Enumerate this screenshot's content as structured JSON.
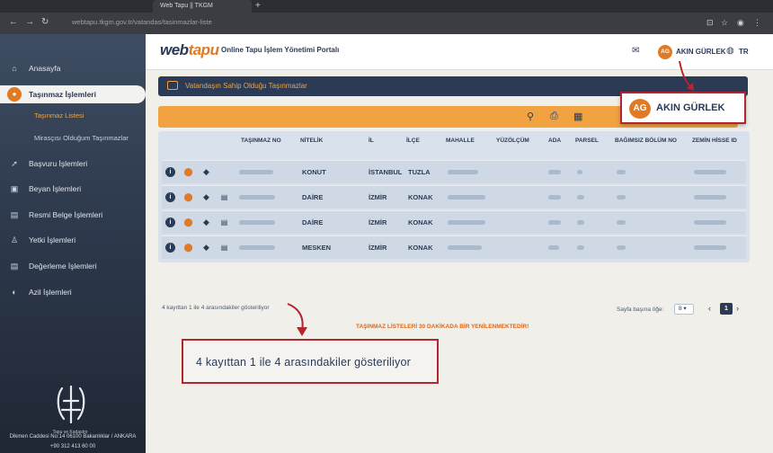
{
  "browser": {
    "tab1_title": "Web Tapu || TKGM",
    "url": "webtapu.tkgm.gov.tr/vatandas/tasinmazlar-liste"
  },
  "header": {
    "logo_main": "web",
    "logo_accent": "tapu",
    "portal_title": "Online Tapu İşlem Yönetimi Portalı",
    "avatar_initials": "AG",
    "user_name": "AKIN GÜRLEK",
    "language": "TR"
  },
  "sidebar": {
    "items": [
      {
        "label": "Anasayfa",
        "icon": "home-icon"
      },
      {
        "label": "Taşınmaz İşlemleri",
        "icon": "location-pin-icon"
      },
      {
        "label": "Başvuru İşlemleri",
        "icon": "rocket-icon"
      },
      {
        "label": "Beyan İşlemleri",
        "icon": "lock-icon"
      },
      {
        "label": "Resmi Belge İşlemleri",
        "icon": "document-icon"
      },
      {
        "label": "Yetki İşlemleri",
        "icon": "user-tie-icon"
      },
      {
        "label": "Değerleme İşlemleri",
        "icon": "document-icon"
      },
      {
        "label": "Azil İşlemleri",
        "icon": "globe-icon"
      }
    ],
    "subitems": [
      "Taşınmaz Listesi",
      "Mirasçısı Olduğum Taşınmazlar"
    ],
    "logo_caption": "Tapu ve Kadastro",
    "footer_address": "Dikmen Caddesi No:14 06100 Bakanlıklar / ANKARA",
    "footer_phone": "+90 312 413 60 00"
  },
  "section": {
    "title": "Vatandaşın Sahip Olduğu Taşınmazlar"
  },
  "table": {
    "columns": [
      "TAŞINMAZ NO",
      "NİTELİK",
      "İL",
      "İLÇE",
      "MAHALLE",
      "YÜZÖLÇÜM",
      "ADA",
      "PARSEL",
      "BAĞIMSIZ BÖLÜM NO",
      "ZEMİN HİSSE ID"
    ],
    "rows": [
      {
        "nitelik": "KONUT",
        "il": "İSTANBUL",
        "ilce": "TUZLA"
      },
      {
        "nitelik": "DAİRE",
        "il": "İZMİR",
        "ilce": "KONAK"
      },
      {
        "nitelik": "DAİRE",
        "il": "İZMİR",
        "ilce": "KONAK"
      },
      {
        "nitelik": "MESKEN",
        "il": "İZMİR",
        "ilce": "KONAK"
      }
    ]
  },
  "footer": {
    "record_count": "4 kayıttan 1 ile 4 arasındakiler gösteriliyor",
    "notice": "TAŞINMAZ LİSTELERİ 30 DAKİKADA BİR YENİLENMEKTEDİR!",
    "per_page_label": "Sayfa başına öğe:",
    "per_page_value": "8",
    "current_page": "1"
  },
  "annotation": {
    "zoom_text": "4 kayıttan 1 ile 4 arasındakiler gösteriliyor",
    "badge_initials": "AG",
    "badge_name": "AKIN GÜRLEK",
    "highlight_color": "#b3262d"
  },
  "colors": {
    "navy": "#2b3a55",
    "orange": "#f0a340",
    "accent": "#e07a24"
  }
}
